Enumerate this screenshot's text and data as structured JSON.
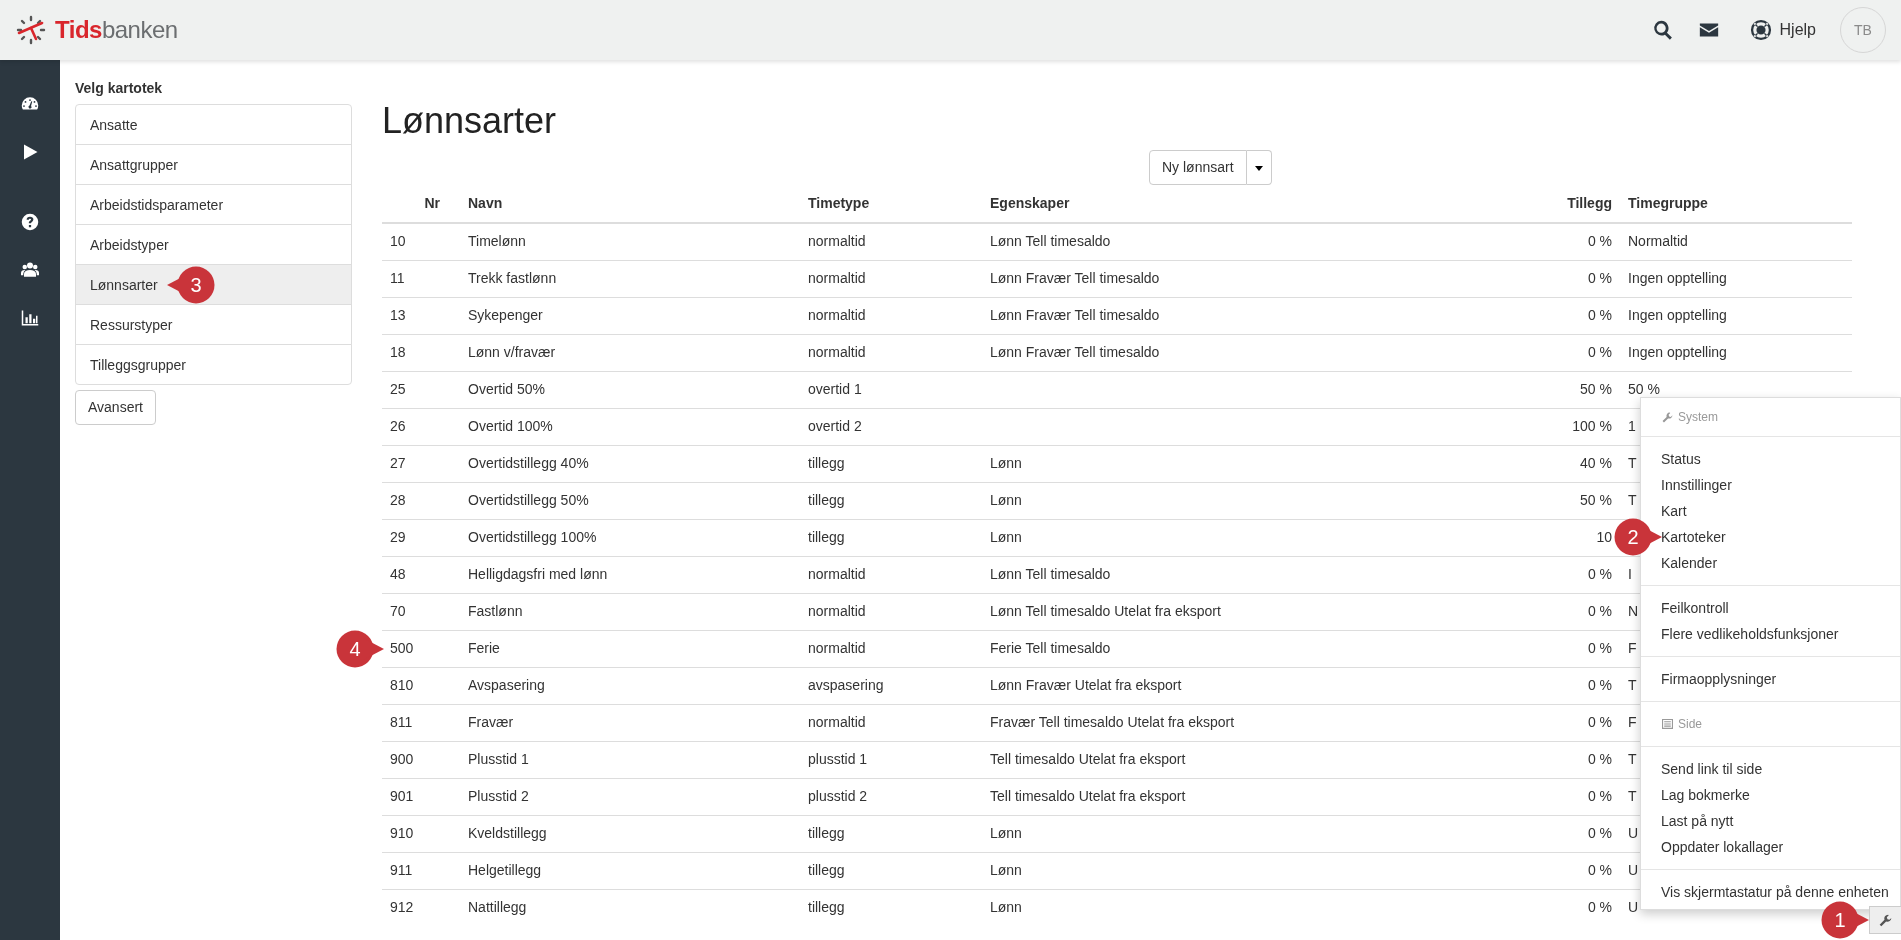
{
  "header": {
    "brand_first": "Tids",
    "brand_rest": "banken",
    "help": "Hjelp",
    "avatar": "TB"
  },
  "register": {
    "title": "Velg kartotek",
    "items": [
      {
        "label": "Ansatte",
        "selected": false
      },
      {
        "label": "Ansattgrupper",
        "selected": false
      },
      {
        "label": "Arbeidstidsparameter",
        "selected": false
      },
      {
        "label": "Arbeidstyper",
        "selected": false
      },
      {
        "label": "Lønnsarter",
        "selected": true,
        "callout": "3"
      },
      {
        "label": "Ressurstyper",
        "selected": false
      },
      {
        "label": "Tilleggsgrupper",
        "selected": false
      }
    ],
    "advanced_button": "Avansert"
  },
  "page": {
    "title": "Lønnsarter",
    "new_button": "Ny lønnsart"
  },
  "table": {
    "columns": [
      "Nr",
      "Navn",
      "Timetype",
      "Egenskaper",
      "Tillegg",
      "Timegruppe"
    ],
    "rows": [
      {
        "nr": "10",
        "navn": "Timelønn",
        "timetype": "normaltid",
        "egenskaper": "Lønn Tell timesaldo",
        "tillegg": "0 %",
        "timegruppe": "Normaltid"
      },
      {
        "nr": "11",
        "navn": "Trekk fastlønn",
        "timetype": "normaltid",
        "egenskaper": "Lønn Fravær Tell timesaldo",
        "tillegg": "0 %",
        "timegruppe": "Ingen opptelling"
      },
      {
        "nr": "13",
        "navn": "Sykepenger",
        "timetype": "normaltid",
        "egenskaper": "Lønn Fravær Tell timesaldo",
        "tillegg": "0 %",
        "timegruppe": "Ingen opptelling"
      },
      {
        "nr": "18",
        "navn": "Lønn v/fravær",
        "timetype": "normaltid",
        "egenskaper": "Lønn Fravær Tell timesaldo",
        "tillegg": "0 %",
        "timegruppe": "Ingen opptelling"
      },
      {
        "nr": "25",
        "navn": "Overtid 50%",
        "timetype": "overtid 1",
        "tillegg": "50 %",
        "timegruppe": "50 %"
      },
      {
        "nr": "26",
        "navn": "Overtid 100%",
        "timetype": "overtid 2",
        "tillegg": "100 %",
        "timegruppe": "1"
      },
      {
        "nr": "27",
        "navn": "Overtidstillegg 40%",
        "timetype": "tillegg",
        "egenskaper": "Lønn",
        "tillegg": "40 %",
        "timegruppe": "T"
      },
      {
        "nr": "28",
        "navn": "Overtidstillegg 50%",
        "timetype": "tillegg",
        "egenskaper": "Lønn",
        "tillegg": "50 %",
        "timegruppe": "T"
      },
      {
        "nr": "29",
        "navn": "Overtidstillegg 100%",
        "timetype": "tillegg",
        "egenskaper": "Lønn",
        "tillegg": "10"
      },
      {
        "nr": "48",
        "navn": "Helligdagsfri med lønn",
        "timetype": "normaltid",
        "egenskaper": "Lønn Tell timesaldo",
        "tillegg": "0 %",
        "timegruppe": "I"
      },
      {
        "nr": "70",
        "navn": "Fastlønn",
        "timetype": "normaltid",
        "egenskaper": "Lønn Tell timesaldo Utelat fra eksport",
        "tillegg": "0 %",
        "timegruppe": "N"
      },
      {
        "nr": "500",
        "navn": "Ferie",
        "timetype": "normaltid",
        "egenskaper": "Ferie Tell timesaldo",
        "tillegg": "0 %",
        "timegruppe": "F",
        "callout": "4"
      },
      {
        "nr": "810",
        "navn": "Avspasering",
        "timetype": "avspasering",
        "egenskaper": "Lønn Fravær Utelat fra eksport",
        "tillegg": "0 %",
        "timegruppe": "T"
      },
      {
        "nr": "811",
        "navn": "Fravær",
        "timetype": "normaltid",
        "egenskaper": "Fravær Tell timesaldo Utelat fra eksport",
        "tillegg": "0 %",
        "timegruppe": "F"
      },
      {
        "nr": "900",
        "navn": "Plusstid 1",
        "timetype": "plusstid 1",
        "egenskaper": "Tell timesaldo Utelat fra eksport",
        "tillegg": "0 %",
        "timegruppe": "T"
      },
      {
        "nr": "901",
        "navn": "Plusstid 2",
        "timetype": "plusstid 2",
        "egenskaper": "Tell timesaldo Utelat fra eksport",
        "tillegg": "0 %",
        "timegruppe": "T"
      },
      {
        "nr": "910",
        "navn": "Kveldstillegg",
        "timetype": "tillegg",
        "egenskaper": "Lønn",
        "tillegg": "0 %",
        "timegruppe": "U"
      },
      {
        "nr": "911",
        "navn": "Helgetillegg",
        "timetype": "tillegg",
        "egenskaper": "Lønn",
        "tillegg": "0 %",
        "timegruppe": "U"
      },
      {
        "nr": "912",
        "navn": "Nattillegg",
        "timetype": "tillegg",
        "egenskaper": "Lønn",
        "tillegg": "0 %",
        "timegruppe": "U"
      }
    ]
  },
  "tools_menu": {
    "groups": [
      {
        "kind": "header",
        "label": "System"
      },
      {
        "kind": "items",
        "items": [
          {
            "label": "Status"
          },
          {
            "label": "Innstillinger"
          },
          {
            "label": "Kart"
          },
          {
            "label": "Kartoteker",
            "callout": "2"
          },
          {
            "label": "Kalender"
          }
        ]
      },
      {
        "kind": "items",
        "items": [
          {
            "label": "Feilkontroll"
          },
          {
            "label": "Flere vedlikeholdsfunksjoner"
          }
        ]
      },
      {
        "kind": "items",
        "items": [
          {
            "label": "Firmaopplysninger"
          }
        ]
      },
      {
        "kind": "header",
        "label": "Side"
      },
      {
        "kind": "items",
        "items": [
          {
            "label": "Send link til side"
          },
          {
            "label": "Lag bokmerke"
          },
          {
            "label": "Last på nytt"
          },
          {
            "label": "Oppdater lokallager"
          }
        ]
      },
      {
        "kind": "items",
        "items": [
          {
            "label": "Vis skjermtastatur på denne enheten"
          }
        ]
      }
    ],
    "button_callout": "1"
  }
}
